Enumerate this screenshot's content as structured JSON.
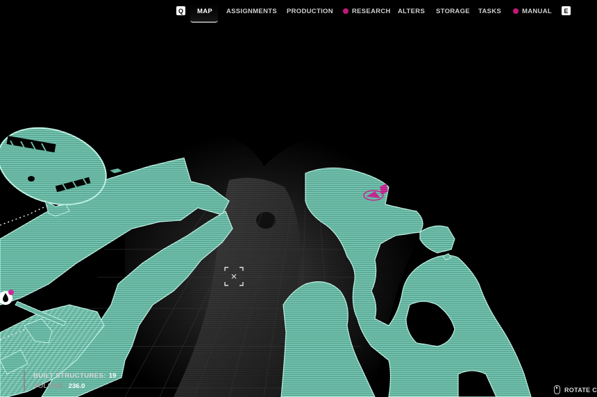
{
  "nav": {
    "prev_key": "Q",
    "next_key": "E",
    "tabs": [
      {
        "label": "MAP",
        "active": true,
        "badge": false
      },
      {
        "label": "ASSIGNMENTS",
        "active": false,
        "badge": false
      },
      {
        "label": "PRODUCTION",
        "active": false,
        "badge": false
      },
      {
        "label": "RESEARCH",
        "active": false,
        "badge": true
      },
      {
        "label": "ALTERS",
        "active": false,
        "badge": false
      },
      {
        "label": "STORAGE",
        "active": false,
        "badge": false
      },
      {
        "label": "TASKS",
        "active": false,
        "badge": false
      },
      {
        "label": "MANUAL",
        "active": false,
        "badge": true
      }
    ]
  },
  "stats": {
    "built_label": "BUILT STRUCTURES:",
    "built_value": "19",
    "volume_label": "VOLUME:",
    "volume_value": "236.0"
  },
  "hint": {
    "rotate_label": "ROTATE CA"
  },
  "colors": {
    "terrain": "#6fc2ad",
    "terrain_edge": "#c9fff0",
    "badge": "#c2187a",
    "marker_pink": "#d02a9a"
  },
  "icons": [
    "crosshair-icon",
    "water-drop-icon",
    "mouse-icon",
    "badge-dot-icon"
  ]
}
